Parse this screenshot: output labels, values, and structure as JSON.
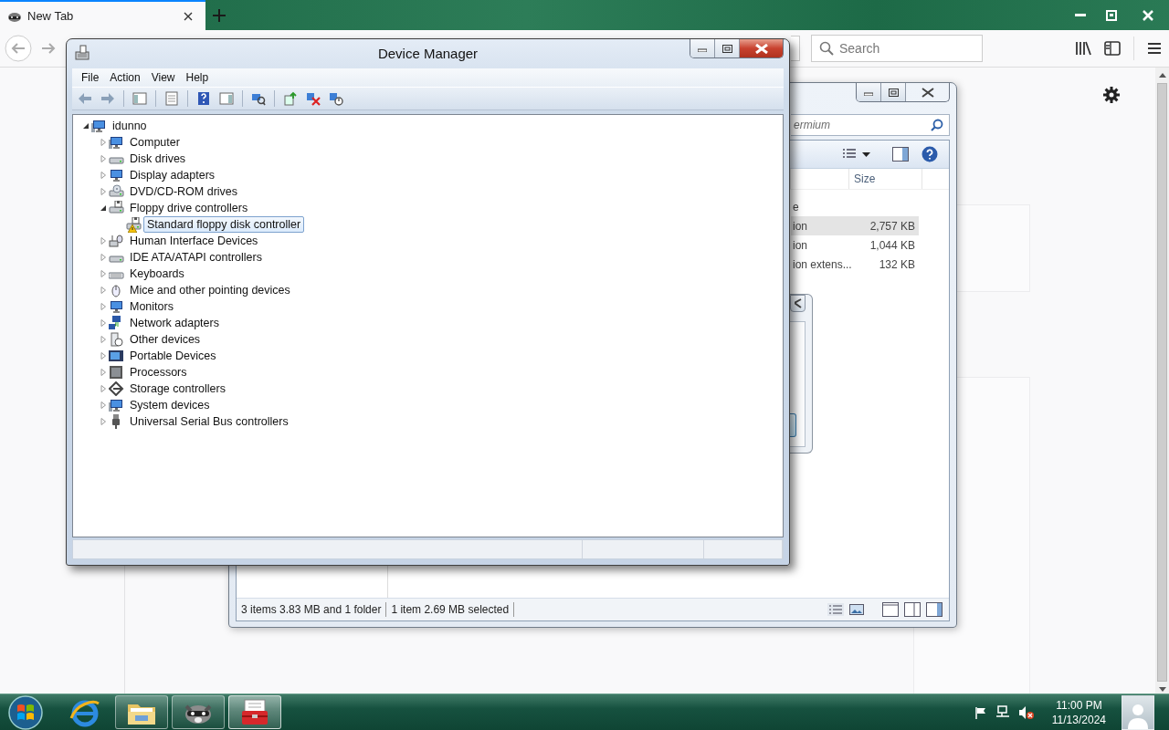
{
  "browser": {
    "tabs": [
      {
        "label": "New Tab",
        "selected": true
      }
    ],
    "search": {
      "placeholder": "Search"
    }
  },
  "explorer": {
    "search": {
      "placeholder": "ermium"
    },
    "columns": [
      {
        "label": "Size"
      }
    ],
    "rows": [
      {
        "type": "e",
        "selected": false
      },
      {
        "type": "ion",
        "size": "2,757 KB",
        "selected": true
      },
      {
        "type": "ion",
        "size": "1,044 KB",
        "selected": false
      },
      {
        "type": "ion extens...",
        "size": "132 KB",
        "selected": false
      }
    ],
    "status": [
      "3 items 3.83 MB and 1 folder",
      "1 item 2.69 MB selected"
    ]
  },
  "device_manager": {
    "title": "Device Manager",
    "menu": [
      "File",
      "Action",
      "View",
      "Help"
    ],
    "tree": {
      "label": "idunno",
      "kind": "computer",
      "expanded": true,
      "selected": false,
      "warning": false,
      "children": [
        {
          "label": "Computer",
          "kind": "computer",
          "expanded": false,
          "selected": false,
          "warning": false
        },
        {
          "label": "Disk drives",
          "kind": "drive",
          "expanded": false,
          "selected": false,
          "warning": false
        },
        {
          "label": "Display adapters",
          "kind": "monitor",
          "expanded": false,
          "selected": false,
          "warning": false
        },
        {
          "label": "DVD/CD-ROM drives",
          "kind": "optical",
          "expanded": false,
          "selected": false,
          "warning": false
        },
        {
          "label": "Floppy drive controllers",
          "kind": "floppy",
          "expanded": true,
          "selected": false,
          "warning": false,
          "children": [
            {
              "label": "Standard floppy disk controller",
              "kind": "floppy",
              "selected": true,
              "warning": true
            }
          ]
        },
        {
          "label": "Human Interface Devices",
          "kind": "hid",
          "expanded": false,
          "selected": false,
          "warning": false
        },
        {
          "label": "IDE ATA/ATAPI controllers",
          "kind": "drive",
          "expanded": false,
          "selected": false,
          "warning": false
        },
        {
          "label": "Keyboards",
          "kind": "keyboard",
          "expanded": false,
          "selected": false,
          "warning": false
        },
        {
          "label": "Mice and other pointing devices",
          "kind": "mouse",
          "expanded": false,
          "selected": false,
          "warning": false
        },
        {
          "label": "Monitors",
          "kind": "monitor",
          "expanded": false,
          "selected": false,
          "warning": false
        },
        {
          "label": "Network adapters",
          "kind": "network",
          "expanded": false,
          "selected": false,
          "warning": false
        },
        {
          "label": "Other devices",
          "kind": "unknown",
          "expanded": false,
          "selected": false,
          "warning": false
        },
        {
          "label": "Portable Devices",
          "kind": "portable",
          "expanded": false,
          "selected": false,
          "warning": false
        },
        {
          "label": "Processors",
          "kind": "chip",
          "expanded": false,
          "selected": false,
          "warning": false
        },
        {
          "label": "Storage controllers",
          "kind": "storage",
          "expanded": false,
          "selected": false,
          "warning": false
        },
        {
          "label": "System devices",
          "kind": "computer",
          "expanded": false,
          "selected": false,
          "warning": false
        },
        {
          "label": "Universal Serial Bus controllers",
          "kind": "usb",
          "expanded": false,
          "selected": false,
          "warning": false
        }
      ]
    }
  },
  "taskbar": {
    "apps": [
      {
        "kind": "browser",
        "running": false,
        "selected": false
      },
      {
        "kind": "folder",
        "running": true,
        "selected": false
      },
      {
        "kind": "animal",
        "running": true,
        "selected": false
      },
      {
        "kind": "toolbox",
        "running": true,
        "selected": true
      }
    ],
    "sound_muted": true,
    "time": "11:00 PM",
    "date": "11/13/2024"
  }
}
